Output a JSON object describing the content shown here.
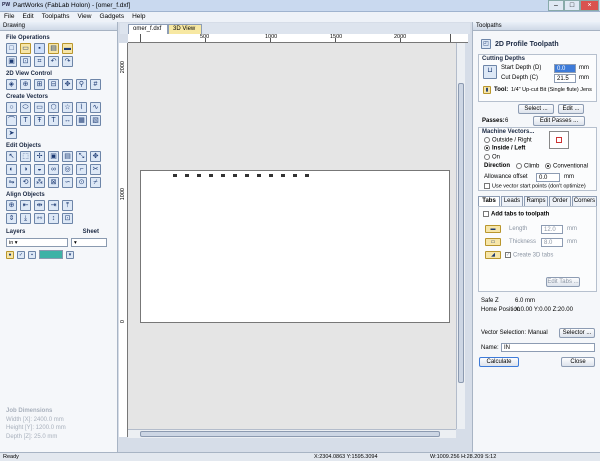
{
  "window": {
    "title": "PartWorks (FabLab Holon) - [omer_f.dxf]"
  },
  "menu": [
    "File",
    "Edit",
    "Toolpaths",
    "View",
    "Gadgets",
    "Help"
  ],
  "left_panel": {
    "header": "Drawing",
    "sections": {
      "file_ops": "File Operations",
      "view_control": "2D View Control",
      "create_vectors": "Create Vectors",
      "edit_objects": "Edit Objects",
      "align_objects": "Align Objects",
      "layers": "Layers",
      "sheet": "Sheet"
    },
    "layer_unit": "in",
    "job_dimensions": {
      "heading": "Job Dimensions",
      "width": "Width  [X]: 2400.0 mm",
      "height": "Height [Y]: 1200.0 mm",
      "depth": "Depth   [Z]: 25.0 mm"
    }
  },
  "doc_tabs": [
    "omer_f.dxf",
    "3D View"
  ],
  "ruler": {
    "top": [
      "500",
      "1000",
      "1500",
      "2000"
    ],
    "left": [
      "2000",
      "1000",
      "0"
    ]
  },
  "right_panel": {
    "header": "Toolpaths",
    "title": "2D Profile Toolpath",
    "cutting_depths": {
      "label": "Cutting Depths",
      "start_label": "Start Depth (D)",
      "start_value": "0.0",
      "cut_label": "Cut Depth (C)",
      "cut_value": "21.5",
      "unit": "mm"
    },
    "tool": {
      "label": "Tool:",
      "name": "1/4\" Up-cut Bit (Single flute) Jens",
      "select": "Select ...",
      "edit": "Edit ..."
    },
    "passes": {
      "label": "Passes:",
      "value": "6",
      "button": "Edit Passes ..."
    },
    "machine_vectors": {
      "label": "Machine Vectors...",
      "options": [
        "Outside / Right",
        "Inside / Left",
        "On"
      ],
      "direction_label": "Direction",
      "direction_options": [
        "Climb",
        "Conventional"
      ],
      "allowance_label": "Allowance offset",
      "allowance_value": "0.0",
      "allowance_unit": "mm",
      "use_start_points": "Use vector start points (don't optimize)"
    },
    "sub_tabs": [
      "Tabs",
      "Leads",
      "Ramps",
      "Order",
      "Corners"
    ],
    "tabs": {
      "add": "Add tabs to toolpath",
      "length_label": "Length",
      "length_value": "12.0",
      "thickness_label": "Thickness",
      "thickness_value": "8.0",
      "unit": "mm",
      "create3d": "Create 3D tabs",
      "edit_button": "Edit Tabs ..."
    },
    "safe_z": {
      "label": "Safe Z",
      "value": "6.0 mm"
    },
    "home": {
      "label": "Home Position",
      "value": "X:0.00 Y:0.00 Z:20.00"
    },
    "vector_selection": {
      "label": "Vector Selection:",
      "value": "Manual",
      "button": "Selector ..."
    },
    "name": {
      "label": "Name:",
      "value": "IN"
    },
    "calculate": "Calculate",
    "close": "Close"
  },
  "status": {
    "left": "Ready",
    "coords": "X:2304.0863 Y:1595.3094",
    "dims": "W:1009.256    H:28.209    S:12"
  }
}
